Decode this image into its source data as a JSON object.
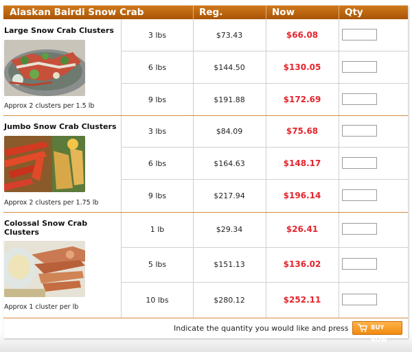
{
  "header": {
    "title": "Alaskan Bairdi Snow Crab",
    "reg": "Reg.",
    "now": "Now",
    "qty": "Qty"
  },
  "products": [
    {
      "name": "Large Snow Crab Clusters",
      "note": "Approx 2 clusters per 1.5 lb",
      "rows": [
        {
          "weight": "3 lbs",
          "reg": "$73.43",
          "now": "$66.08"
        },
        {
          "weight": "6 lbs",
          "reg": "$144.50",
          "now": "$130.05"
        },
        {
          "weight": "9 lbs",
          "reg": "$191.88",
          "now": "$172.69"
        }
      ]
    },
    {
      "name": "Jumbo Snow Crab Clusters",
      "note": "Approx 2 clusters per 1.75 lb",
      "rows": [
        {
          "weight": "3 lbs",
          "reg": "$84.09",
          "now": "$75.68"
        },
        {
          "weight": "6 lbs",
          "reg": "$164.63",
          "now": "$148.17"
        },
        {
          "weight": "9 lbs",
          "reg": "$217.94",
          "now": "$196.14"
        }
      ]
    },
    {
      "name": "Colossal Snow Crab Clusters",
      "note": "Approx 1 cluster per lb",
      "rows": [
        {
          "weight": "1 lb",
          "reg": "$29.34",
          "now": "$26.41"
        },
        {
          "weight": "5 lbs",
          "reg": "$151.13",
          "now": "$136.02"
        },
        {
          "weight": "10 lbs",
          "reg": "$280.12",
          "now": "$252.11"
        }
      ]
    }
  ],
  "footer": {
    "instruction": "Indicate the quantity you would like and press",
    "buy_label": "BUY NOW"
  },
  "colors": {
    "header_bg": "#b8640c",
    "sale_price": "#e4242c",
    "buy_button": "#f08a10"
  }
}
